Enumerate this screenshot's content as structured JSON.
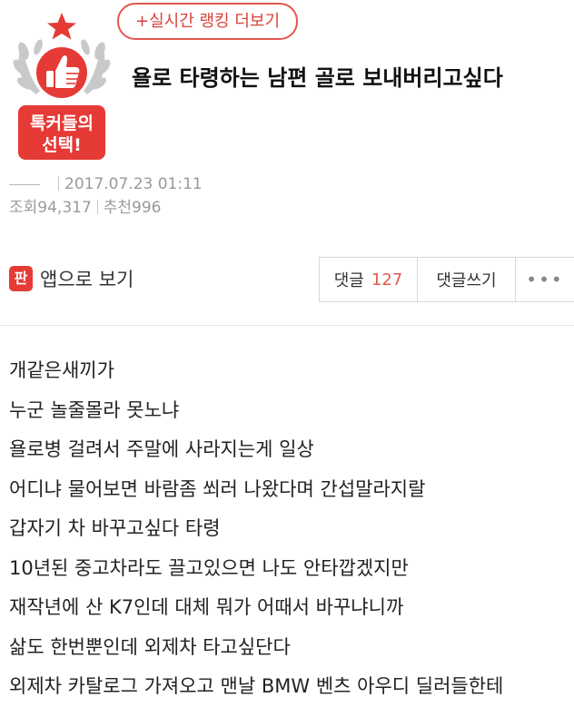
{
  "header": {
    "ranking_button": "+실시간 랭킹 더보기",
    "title": "욜로 타령하는 남편 골로 보내버리고싶다",
    "badge": {
      "line1": "톡커들의",
      "line2": "선택!"
    }
  },
  "meta": {
    "date": "2017.07.23 01:11",
    "views_label": "조회",
    "views": "94,317",
    "likes_label": "추천",
    "likes": "996"
  },
  "actions": {
    "app_icon_glyph": "판",
    "app_view": "앱으로 보기",
    "comments_label": "댓글",
    "comments_count": "127",
    "write_comment": "댓글쓰기",
    "more": "•••"
  },
  "body": {
    "lines": [
      "개같은새끼가",
      "누군 놀줄몰라 못노냐",
      "욜로병 걸려서 주말에 사라지는게 일상",
      "어디냐 물어보면 바람좀 쐬러 나왔다며 간섭말라지랄",
      "갑자기 차 바꾸고싶다 타령",
      "10년된 중고차라도 끌고있으면 나도 안타깝겠지만",
      "재작년에 산 K7인데 대체 뭐가 어때서 바꾸냐니까",
      "삶도 한번뿐인데 외제차 타고싶단다",
      "외제차 카탈로그 가져오고 맨날 BMW 벤츠 아우디 딜러들한테"
    ]
  },
  "colors": {
    "accent": "#e2584e",
    "badge_red": "#e53a35",
    "laurel_gray": "#c9c9c9",
    "meta_gray": "#9a9a9a"
  },
  "icons": {
    "badge": "thumbs-up-laurel-badge",
    "app": "pann-app-icon",
    "more": "more-dots-icon"
  }
}
